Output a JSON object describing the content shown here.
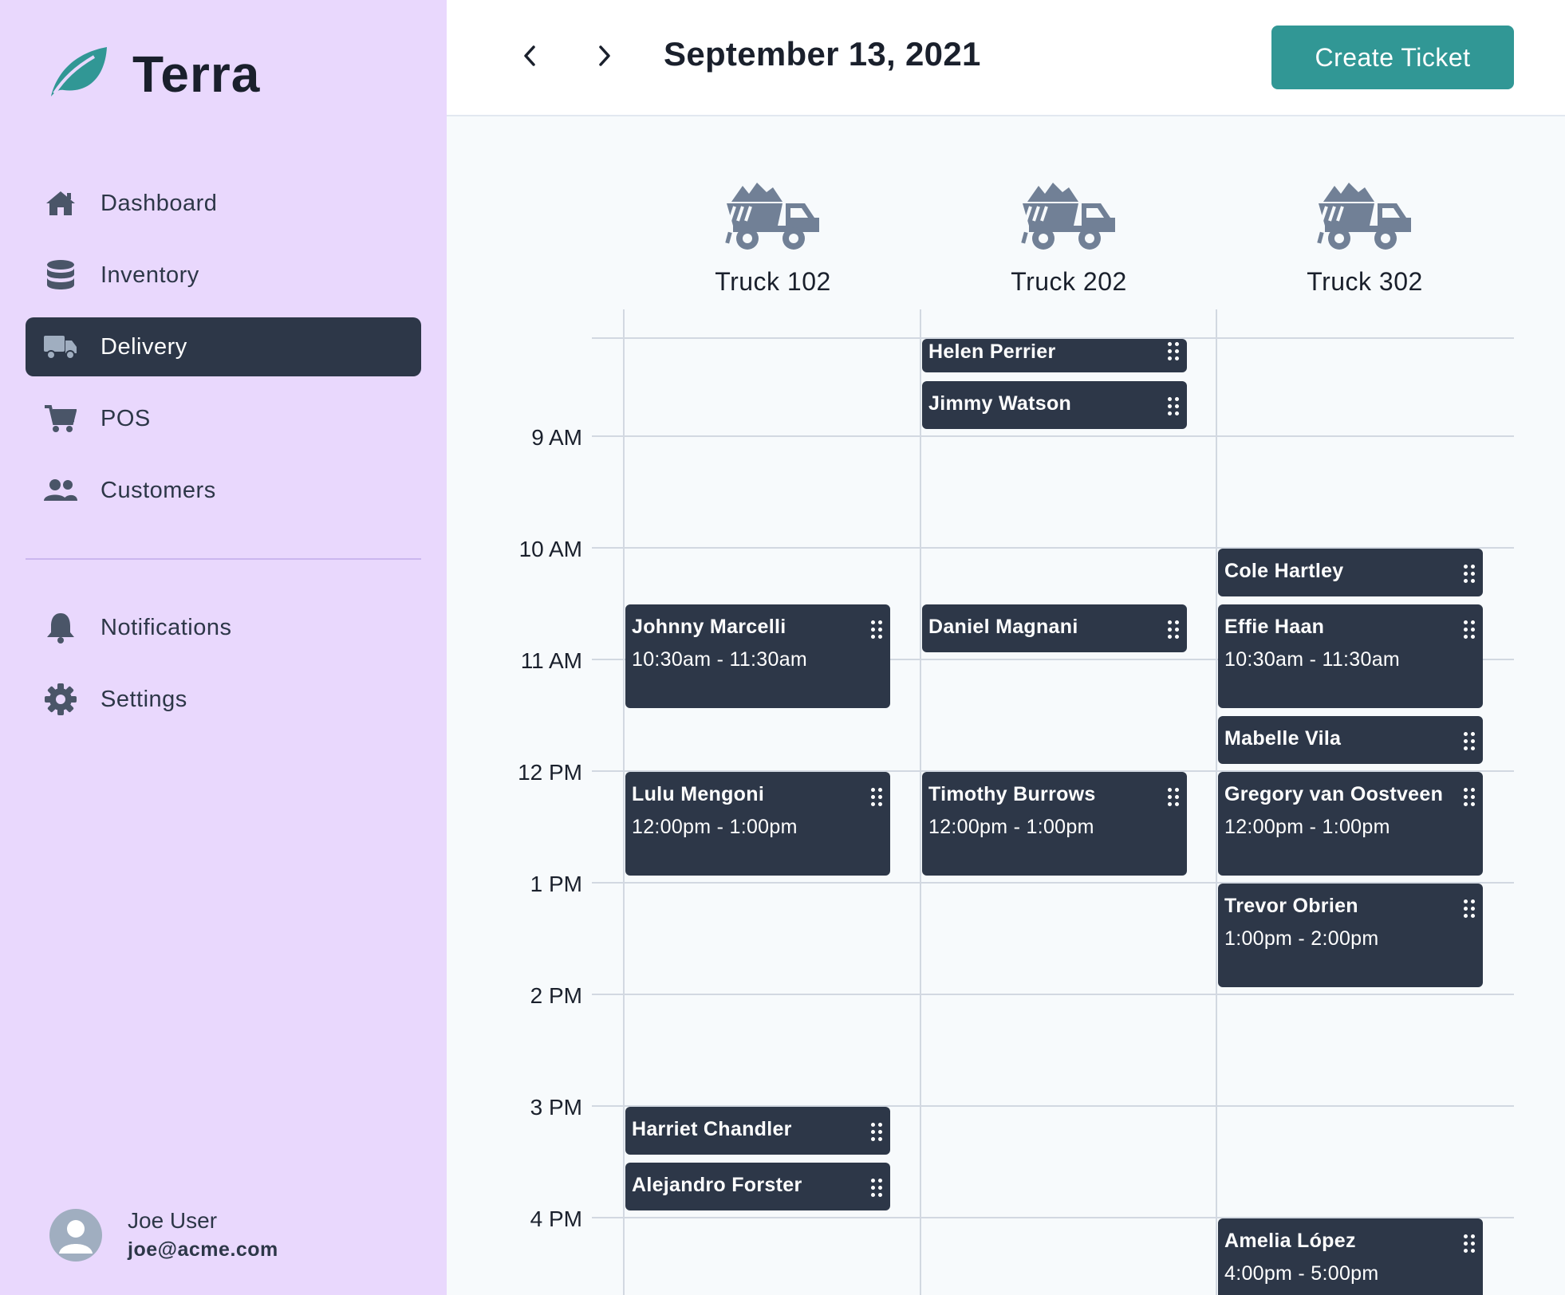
{
  "app": {
    "name": "Terra"
  },
  "sidebar": {
    "items": [
      {
        "label": "Dashboard",
        "icon": "home-icon"
      },
      {
        "label": "Inventory",
        "icon": "database-icon"
      },
      {
        "label": "Delivery",
        "icon": "truck-icon",
        "active": true
      },
      {
        "label": "POS",
        "icon": "cart-icon"
      },
      {
        "label": "Customers",
        "icon": "users-icon"
      }
    ],
    "secondary_items": [
      {
        "label": "Notifications",
        "icon": "bell-icon"
      },
      {
        "label": "Settings",
        "icon": "gear-icon"
      }
    ],
    "user": {
      "name": "Joe User",
      "email": "joe@acme.com"
    }
  },
  "header": {
    "date": "September 13, 2021",
    "create_label": "Create Ticket"
  },
  "calendar": {
    "trucks": [
      "Truck 102",
      "Truck 202",
      "Truck 302"
    ],
    "time_labels": [
      "9 AM",
      "10 AM",
      "11 AM",
      "12 PM",
      "1 PM",
      "2 PM",
      "3 PM",
      "4 PM"
    ],
    "events": {
      "truck102": [
        {
          "name": "Johnny Marcelli",
          "time": "10:30am - 11:30am"
        },
        {
          "name": "Lulu Mengoni",
          "time": "12:00pm - 1:00pm"
        },
        {
          "name": "Harriet Chandler"
        },
        {
          "name": "Alejandro Forster"
        }
      ],
      "truck202": [
        {
          "name": "Helen Perrier"
        },
        {
          "name": "Jimmy Watson"
        },
        {
          "name": "Daniel Magnani"
        },
        {
          "name": "Timothy Burrows",
          "time": "12:00pm - 1:00pm"
        }
      ],
      "truck302": [
        {
          "name": "Cole Hartley"
        },
        {
          "name": "Effie Haan",
          "time": "10:30am - 11:30am"
        },
        {
          "name": "Mabelle Vila"
        },
        {
          "name": "Gregory van Oostveen",
          "time": "12:00pm - 1:00pm"
        },
        {
          "name": "Trevor Obrien",
          "time": "1:00pm - 2:00pm"
        },
        {
          "name": "Amelia López",
          "time": "4:00pm - 5:00pm"
        }
      ]
    }
  },
  "colors": {
    "sidebar_bg": "#e9d8fd",
    "active_bg": "#2d3748",
    "accent": "#319795",
    "event_bg": "#2d3748"
  }
}
